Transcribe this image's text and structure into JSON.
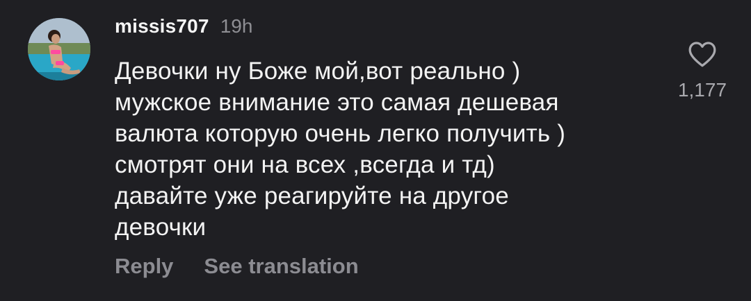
{
  "comment": {
    "username": "missis707",
    "timestamp": "19h",
    "text": "Девочки ну Боже мой,вот реально )\nмужское внимание это самая дешевая\nвалюта которую очень легко получить )\nсмотрят они на всех ,всегда и тд)\nдавайте уже реагируйте на другое\nдевочки",
    "like_count": "1,177",
    "reply_label": "Reply",
    "translate_label": "See translation"
  },
  "icons": {
    "like": "heart-outline-icon",
    "avatar": "user-avatar"
  },
  "colors": {
    "background": "#1f1f23",
    "text": "#f3f3f3",
    "muted": "#8e8e93"
  }
}
